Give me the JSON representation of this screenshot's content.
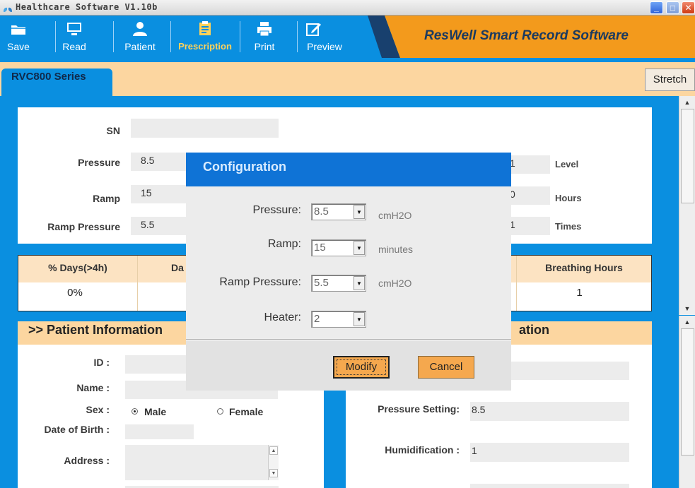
{
  "window": {
    "title": "Healthcare Software V1.10b",
    "controls": {
      "minimize": "_",
      "maximize": "□",
      "close": "✕"
    }
  },
  "toolbar": {
    "items": [
      {
        "label": "Save",
        "icon": "folder-icon"
      },
      {
        "label": "Read",
        "icon": "monitor-icon"
      },
      {
        "label": "Patient",
        "icon": "person-icon"
      },
      {
        "label": "Prescription",
        "icon": "clipboard-icon",
        "active": true
      },
      {
        "label": "Print",
        "icon": "printer-icon"
      },
      {
        "label": "Preview",
        "icon": "edit-icon"
      }
    ],
    "brand": "ResWell Smart Record Software"
  },
  "tabs": {
    "active": "RVC800 Series",
    "stretch": "Stretch"
  },
  "settings_panel": {
    "sn_label": "SN",
    "sn_value": "",
    "pressure_label": "Pressure",
    "pressure_value": "8.5",
    "ramp_label": "Ramp",
    "ramp_value": "15",
    "ramp_pressure_label": "Ramp Pressure",
    "ramp_pressure_value": "5.5",
    "right_values": [
      "1",
      "0",
      "1"
    ],
    "level_unit": "Level",
    "hours_unit": "Hours",
    "times_unit": "Times"
  },
  "stats": {
    "headers": [
      "% Days(>4h)",
      "Da",
      "Breathing Hours"
    ],
    "values": [
      "0%",
      "",
      "1"
    ]
  },
  "patient": {
    "title": ">> Patient Information",
    "id_label": "ID :",
    "name_label": "Name :",
    "sex_label": "Sex :",
    "male": "Male",
    "female": "Female",
    "dob_label": "Date of Birth :",
    "address_label": "Address :"
  },
  "device": {
    "title_fragment": "ation",
    "pressure_setting_label": "Pressure Setting:",
    "pressure_setting_value": "8.5",
    "humidification_label": "Humidification :",
    "humidification_value": "1"
  },
  "dialog": {
    "title": "Configuration",
    "pressure_label": "Pressure:",
    "pressure_value": "8.5",
    "pressure_unit": "cmH2O",
    "ramp_label": "Ramp:",
    "ramp_value": "15",
    "ramp_unit": "minutes",
    "ramp_pressure_label": "Ramp Pressure:",
    "ramp_pressure_value": "5.5",
    "ramp_pressure_unit": "cmH2O",
    "heater_label": "Heater:",
    "heater_value": "2",
    "modify": "Modify",
    "cancel": "Cancel"
  },
  "colors": {
    "toolbar_blue": "#0a8fe0",
    "brand_orange": "#f39a1c",
    "tan": "#fcd6a0",
    "dialog_header": "#0f73d6",
    "button_orange": "#f5a84e",
    "active_tool": "#ffd25a"
  }
}
